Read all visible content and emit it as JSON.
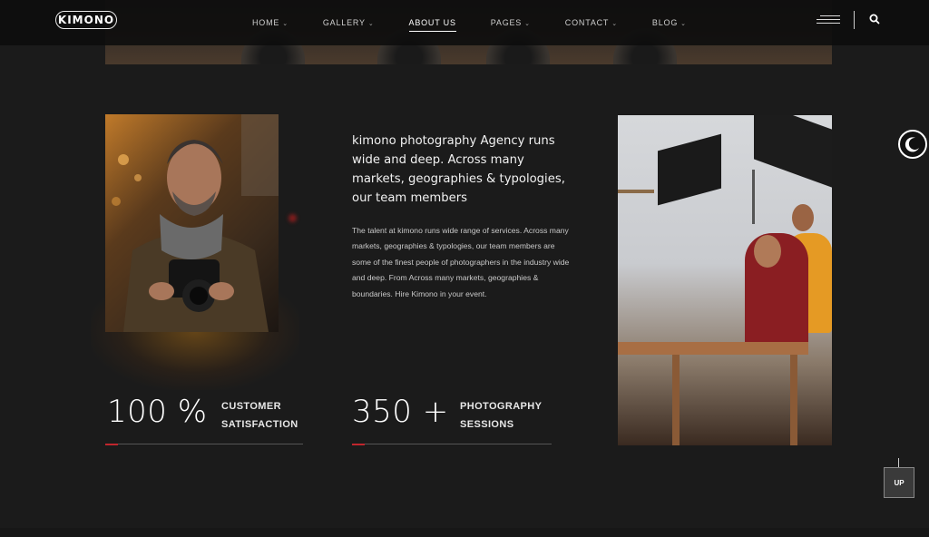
{
  "header": {
    "logo_text": "KIMONO",
    "nav": [
      {
        "label": "HOME",
        "has_dropdown": true,
        "active": false
      },
      {
        "label": "GALLERY",
        "has_dropdown": true,
        "active": false
      },
      {
        "label": "ABOUT US",
        "has_dropdown": false,
        "active": true
      },
      {
        "label": "PAGES",
        "has_dropdown": true,
        "active": false
      },
      {
        "label": "CONTACT",
        "has_dropdown": true,
        "active": false
      },
      {
        "label": "BLOG",
        "has_dropdown": true,
        "active": false
      }
    ],
    "icons": [
      "menu-icon",
      "search-icon"
    ]
  },
  "about": {
    "headline": "kimono photography Agency runs wide and deep. Across many markets, geographies & typologies, our team members",
    "body": "The talent at kimono runs wide range of services. Across many markets, geographies & typologies, our team members are some of the finest people of photographers in the industry wide and deep. From Across many markets, geographies & boundaries. Hire Kimono in your event."
  },
  "stats": [
    {
      "number": "100 %",
      "label_line1": "CUSTOMER",
      "label_line2": "SATISFACTION"
    },
    {
      "number": "350 +",
      "label_line1": "PHOTOGRAPHY",
      "label_line2": "SESSIONS"
    }
  ],
  "controls": {
    "up_label": "UP",
    "theme_icon": "moon-icon"
  },
  "colors": {
    "background": "#1b1b1b",
    "accent_red": "#c0262d",
    "header_bg": "#0c0c0c"
  }
}
